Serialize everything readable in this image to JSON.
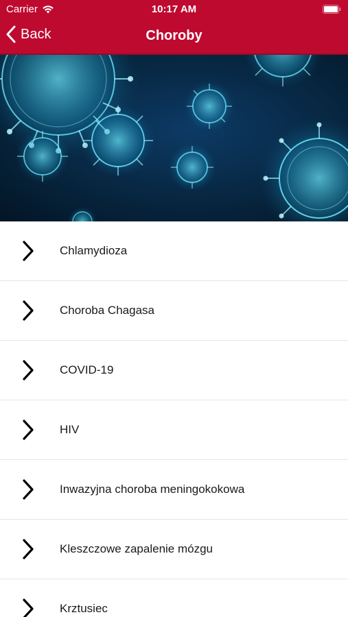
{
  "status_bar": {
    "carrier": "Carrier",
    "time": "10:17 AM",
    "icons": [
      "wifi-icon",
      "battery-icon"
    ]
  },
  "nav": {
    "back_label": "Back",
    "title": "Choroby",
    "background_color": "#bf0a30"
  },
  "hero": {
    "description_icon": "virus-image"
  },
  "diseases": [
    {
      "label": "Chlamydioza",
      "icon": "chevron-right-icon"
    },
    {
      "label": "Choroba Chagasa",
      "icon": "chevron-right-icon"
    },
    {
      "label": "COVID-19",
      "icon": "chevron-right-icon"
    },
    {
      "label": "HIV",
      "icon": "chevron-right-icon"
    },
    {
      "label": "Inwazyjna choroba meningokokowa",
      "icon": "chevron-right-icon"
    },
    {
      "label": "Kleszczowe zapalenie mózgu",
      "icon": "chevron-right-icon"
    },
    {
      "label": "Krztusiec",
      "icon": "chevron-right-icon"
    }
  ]
}
